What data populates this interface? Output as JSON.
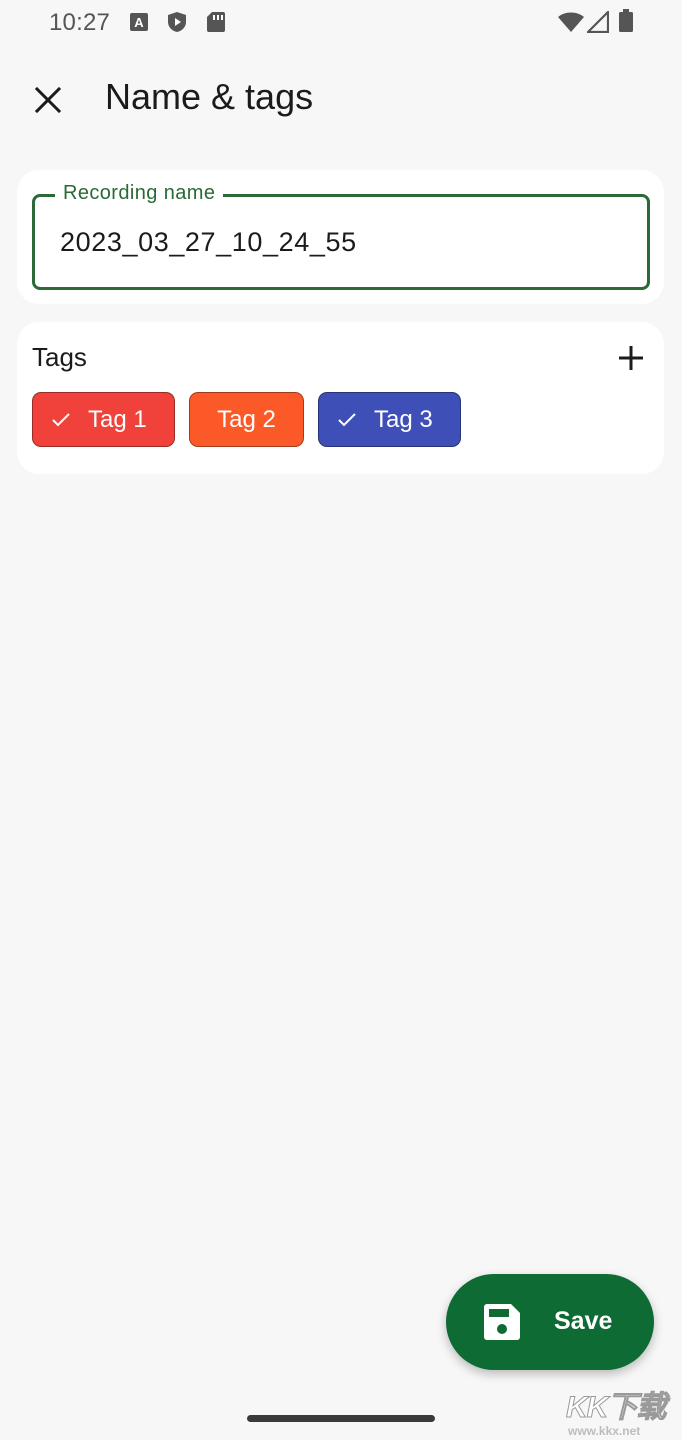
{
  "status_bar": {
    "time": "10:27",
    "left_icons": [
      "a-letter-icon",
      "shield-play-icon",
      "sd-card-icon"
    ],
    "right_icons": [
      "wifi-icon",
      "cell-signal-icon",
      "battery-icon"
    ]
  },
  "app_bar": {
    "close_icon": "close-icon",
    "title": "Name & tags"
  },
  "name_card": {
    "label": "Recording name",
    "value": "2023_03_27_10_24_55",
    "accent_color": "#2a6a36"
  },
  "tags_card": {
    "title": "Tags",
    "add_icon": "plus-icon",
    "chips": [
      {
        "label": "Tag 1",
        "selected": true,
        "color": "#f0413a"
      },
      {
        "label": "Tag 2",
        "selected": false,
        "color": "#fb5a28"
      },
      {
        "label": "Tag 3",
        "selected": true,
        "color": "#3f4fb8"
      }
    ]
  },
  "fab": {
    "icon": "save-icon",
    "label": "Save",
    "color": "#0d6b33"
  },
  "watermark": {
    "logo": "KK下载",
    "url": "www.kkx.net"
  }
}
